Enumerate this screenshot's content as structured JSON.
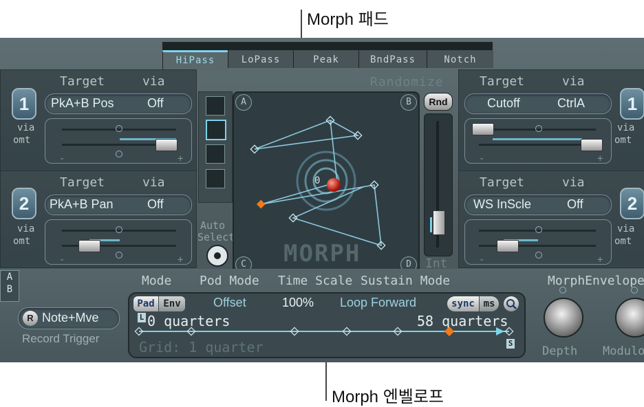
{
  "callouts": {
    "top": "Morph 패드",
    "bottom": "Morph 엔벨로프"
  },
  "filter_tabs": [
    "HiPass",
    "LoPass",
    "Peak",
    "BndPass",
    "Notch"
  ],
  "randomize_label": "Randomize",
  "rnd_button": "Rnd",
  "int_label": "Int",
  "auto_select": {
    "line1": "Auto",
    "line2": "Select"
  },
  "morph_pad": {
    "corners": [
      "A",
      "B",
      "C",
      "D"
    ],
    "center_label": "0",
    "logo": "MORPH"
  },
  "left_mods": [
    {
      "number": "1",
      "target_header": "Target",
      "via_header": "via",
      "target": "PkA+B Pos",
      "via": "Off",
      "via_label": "via",
      "amt_label": "omt",
      "minus": "-",
      "plus": "+",
      "amount": 0.85
    },
    {
      "number": "2",
      "target_header": "Target",
      "via_header": "via",
      "target": "PkA+B Pan",
      "via": "Off",
      "via_label": "via",
      "amt_label": "omt",
      "minus": "-",
      "plus": "+",
      "amount": 0.25
    }
  ],
  "right_mods": [
    {
      "number": "1",
      "target_header": "Target",
      "via_header": "via",
      "target": "Cutoff",
      "via": "CtrlA",
      "via_label": "via",
      "amt_label": "omt",
      "minus": "-",
      "plus": "+"
    },
    {
      "number": "2",
      "target_header": "Target",
      "via_header": "via",
      "target": "WS InScle",
      "via": "Off",
      "via_label": "via",
      "amt_label": "omt",
      "minus": "-",
      "plus": "+"
    }
  ],
  "ab_toggle": {
    "a": "A",
    "b": "B"
  },
  "section_labels": {
    "mode": "Mode",
    "pod_mode": "Pod Mode",
    "time_scale": "Time Scale",
    "sustain_mode": "Sustain Mode",
    "morph_envelope": "MorphEnvelope"
  },
  "record_trigger": {
    "r": "R",
    "mode": "Note+Mve",
    "label": "Record Trigger"
  },
  "envelope": {
    "pad_btn": "Pad",
    "env_btn": "Env",
    "offset": "Offset",
    "time_scale": "100%",
    "sustain": "Loop Forward",
    "sync": "sync",
    "ms": "ms",
    "l_marker": "L",
    "s_marker": "S",
    "start": "0 quarters",
    "end": "58 quarters",
    "grid": "Grid: 1 quarter"
  },
  "knobs": {
    "depth": "Depth",
    "modulation": "Modulo"
  }
}
